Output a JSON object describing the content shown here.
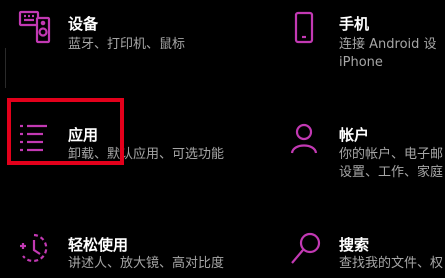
{
  "accent_color": "#c239b3",
  "highlight_color": "#e3001b",
  "tiles": [
    {
      "title": "设备",
      "desc_lines": [
        "蓝牙、打印机、鼠标"
      ],
      "icon": "devices-icon"
    },
    {
      "title": "手机",
      "desc_lines": [
        "连接 Android 设",
        "iPhone"
      ],
      "icon": "phone-icon"
    },
    {
      "title": "应用",
      "desc_lines": [
        "卸载、默认应用、可选功能"
      ],
      "icon": "apps-icon"
    },
    {
      "title": "帐户",
      "desc_lines": [
        "你的帐户、电子邮",
        "设置、工作、家庭"
      ],
      "icon": "account-icon"
    },
    {
      "title": "轻松使用",
      "desc_lines": [
        "讲述人、放大镜、高对比度"
      ],
      "icon": "ease-of-access-icon"
    },
    {
      "title": "搜索",
      "desc_lines": [
        "查找我的文件、权"
      ],
      "icon": "search-icon"
    }
  ]
}
